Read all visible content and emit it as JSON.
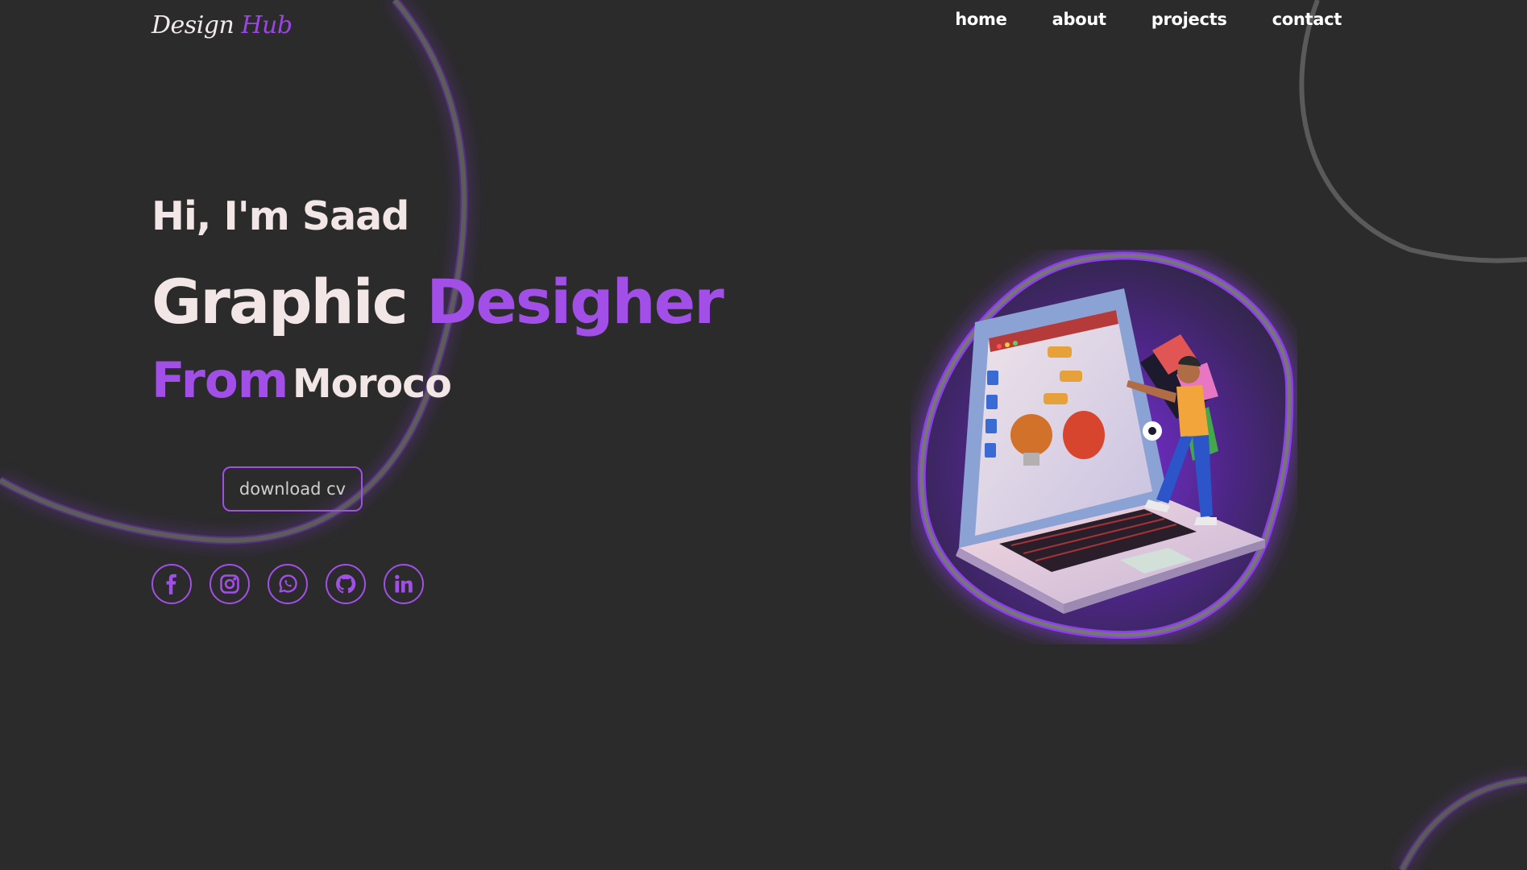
{
  "logo": {
    "part1": "Design",
    "part2": "Hub"
  },
  "nav": {
    "home": "home",
    "about": "about",
    "projects": "projects",
    "contact": "contact"
  },
  "hero": {
    "greeting": "Hi, I'm Saad",
    "role_word1": "Graphic",
    "role_word2": "Desigher",
    "from_word": "From",
    "place": "Moroco"
  },
  "cta": {
    "download_label": "download cv"
  },
  "socials": [
    "facebook-icon",
    "instagram-icon",
    "whatsapp-icon",
    "github-icon",
    "linkedin-icon"
  ],
  "colors": {
    "background": "#2b2b2b",
    "accent": "#a24fe8",
    "text": "#f2e6e6",
    "blob_stroke": "#5a5a5a"
  }
}
